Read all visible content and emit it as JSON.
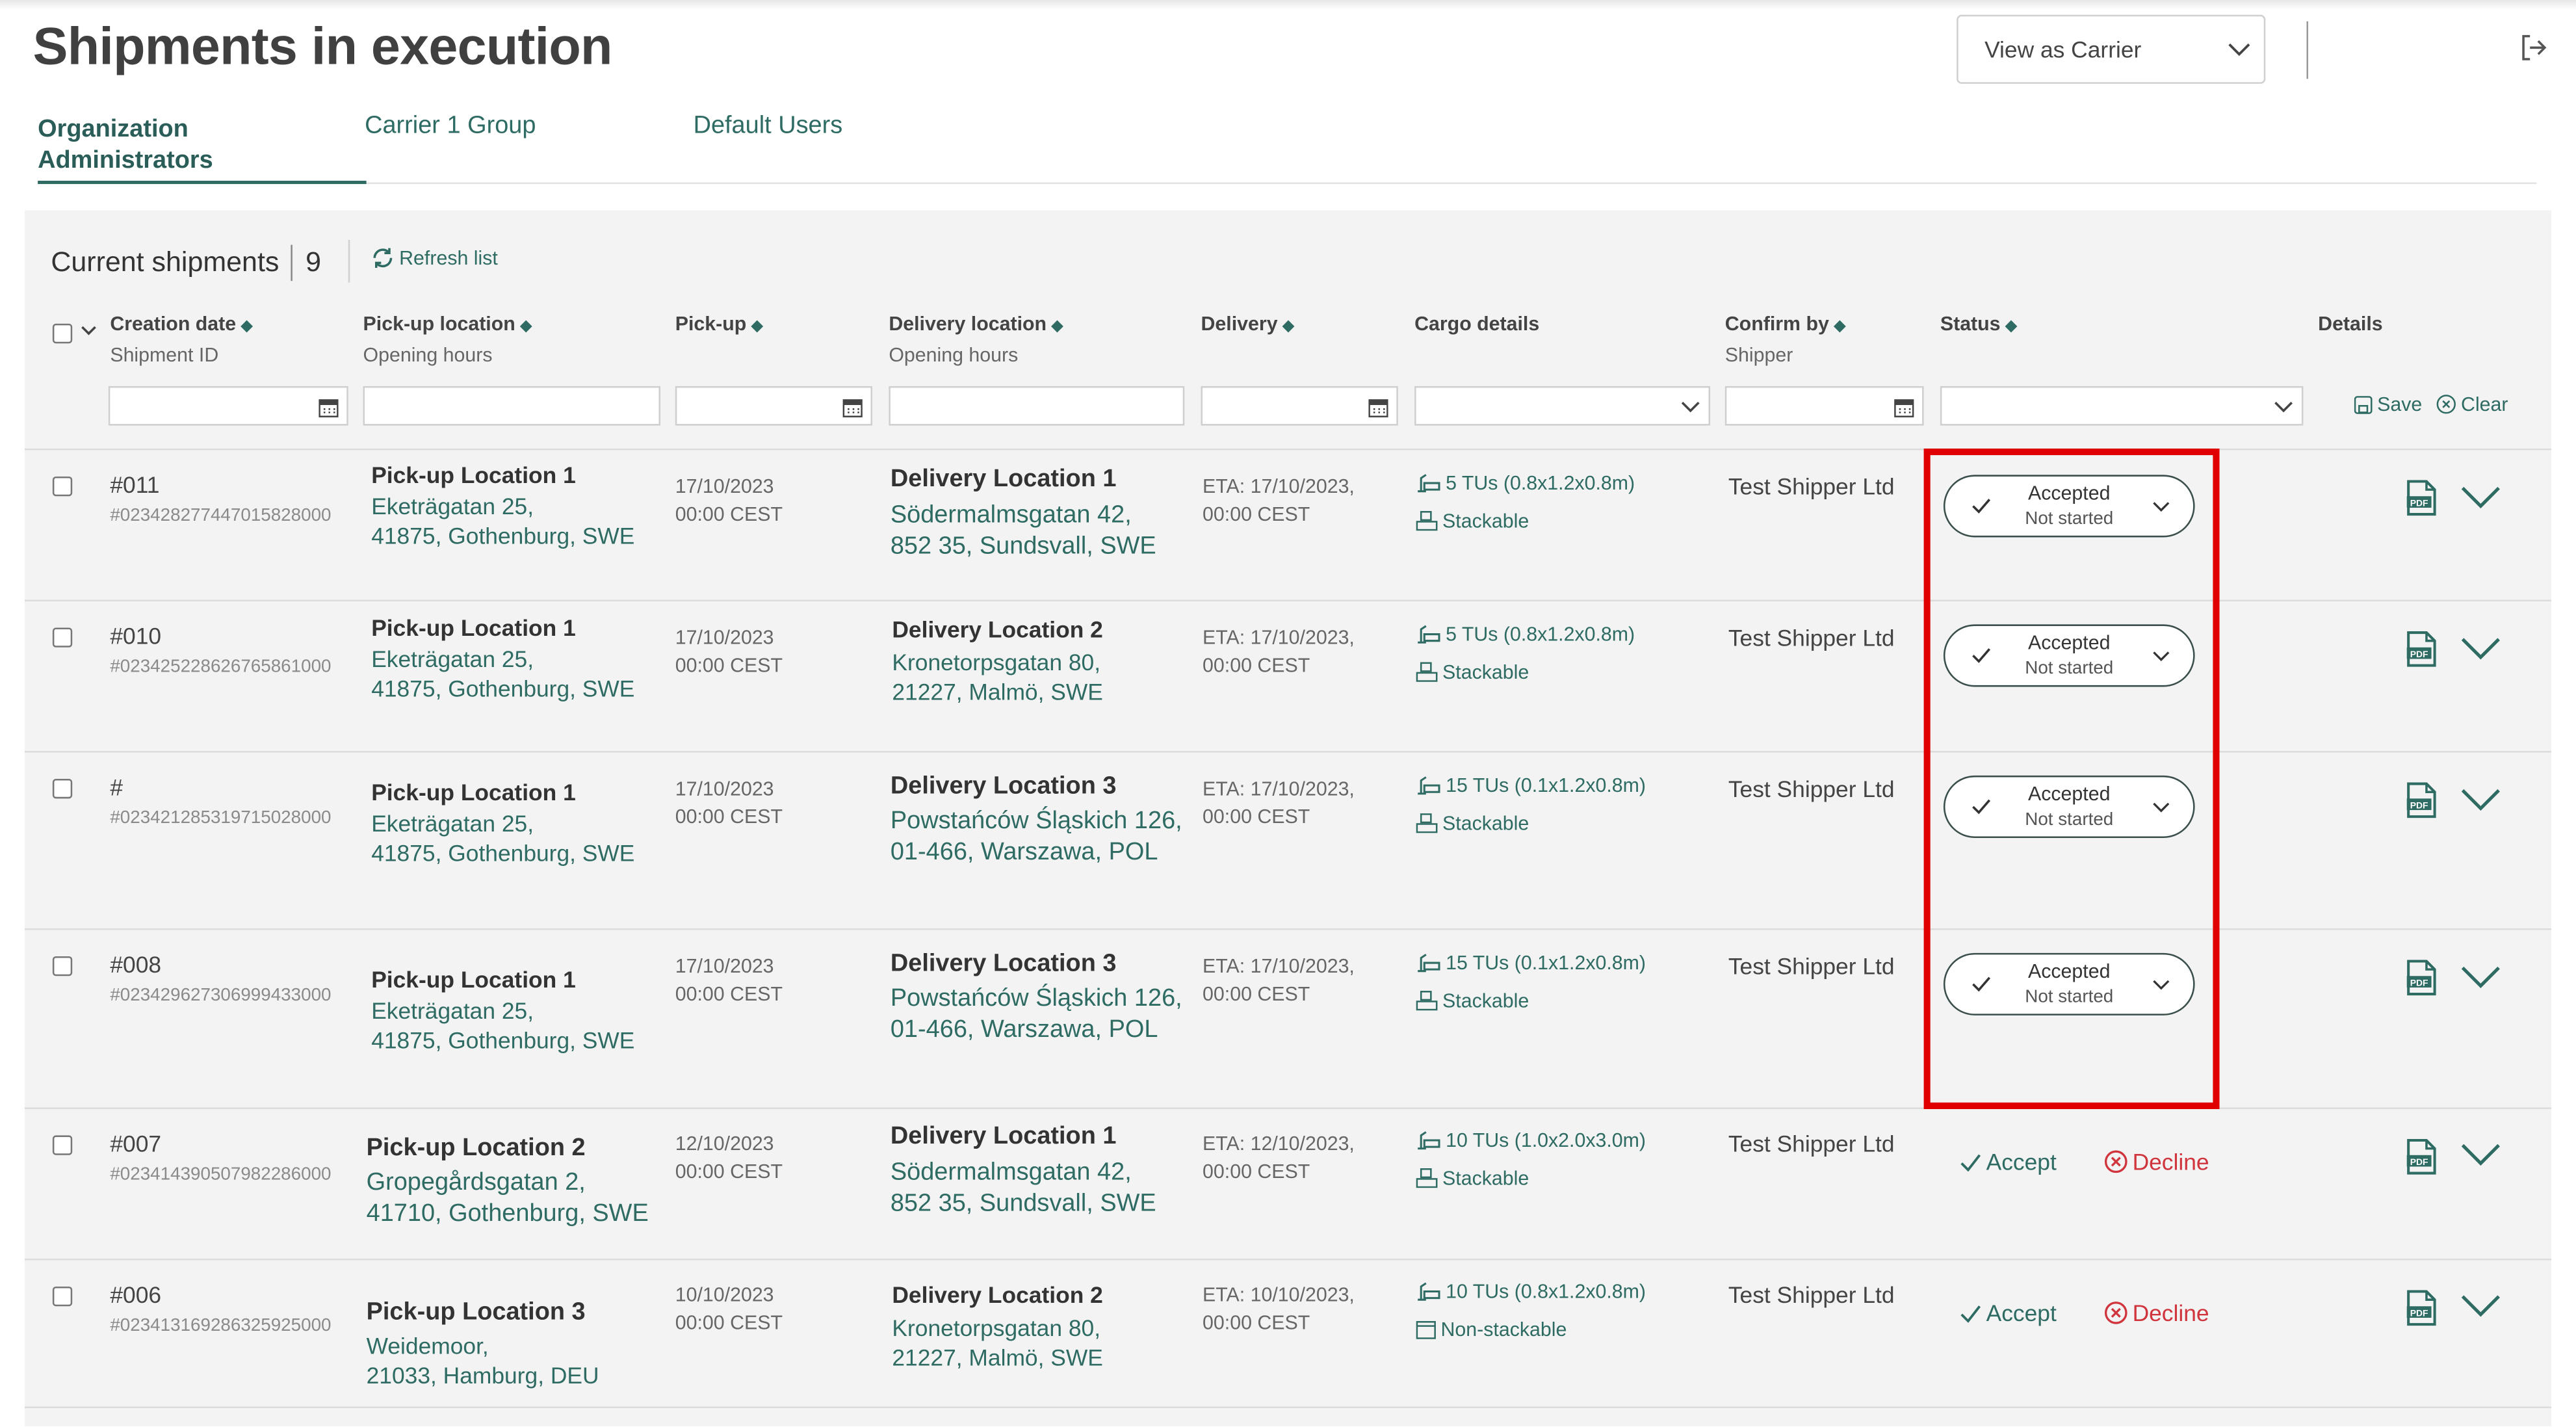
{
  "header": {
    "title": "Shipments in execution",
    "view_as": "View as Carrier"
  },
  "tabs": [
    {
      "label": "Organization Administrators",
      "active": true
    },
    {
      "label": "Carrier 1 Group",
      "active": false
    },
    {
      "label": "Default Users",
      "active": false
    }
  ],
  "toolbar": {
    "current_label": "Current shipments",
    "count": "9",
    "refresh_label": "Refresh list"
  },
  "columns": {
    "creation": "Creation date",
    "creation_sub": "Shipment ID",
    "pickup_loc": "Pick-up location",
    "pickup_loc_sub": "Opening hours",
    "pickup": "Pick-up",
    "delivery_loc": "Delivery location",
    "delivery_loc_sub": "Opening hours",
    "delivery": "Delivery",
    "cargo": "Cargo details",
    "confirm": "Confirm by",
    "confirm_sub": "Shipper",
    "status": "Status",
    "details": "Details"
  },
  "filters": {
    "save_label": "Save",
    "clear_label": "Clear"
  },
  "actions": {
    "accept": "Accept",
    "decline": "Decline"
  },
  "colors": {
    "accent": "#2e6b63",
    "decline": "#d0343c",
    "highlight": "#e00000"
  },
  "rows": [
    {
      "id": "#011",
      "long_id": "#023428277447015828000",
      "pickup_name": "Pick-up Location 1",
      "pickup_addr1": "Eketrägatan 25,",
      "pickup_addr2": "41875, Gothenburg, SWE",
      "pickup_date": "17/10/2023",
      "pickup_time": "00:00 CEST",
      "delivery_name": "Delivery Location 1",
      "delivery_addr1": "Södermalmsgatan 42,",
      "delivery_addr2": "852 35, Sundsvall, SWE",
      "eta": "ETA:  17/10/2023,",
      "eta_time": "00:00 CEST",
      "cargo": "5 TUs (0.8x1.2x0.8m)",
      "stack": "Stackable",
      "stackable": true,
      "shipper": "Test Shipper Ltd",
      "status": "Accepted",
      "status_sub": "Not started"
    },
    {
      "id": "#010",
      "long_id": "#023425228626765861000",
      "pickup_name": "Pick-up Location 1",
      "pickup_addr1": "Eketrägatan 25,",
      "pickup_addr2": "41875, Gothenburg, SWE",
      "pickup_date": "17/10/2023",
      "pickup_time": "00:00 CEST",
      "delivery_name": "Delivery Location 2",
      "delivery_addr1": "Kronetorpsgatan 80,",
      "delivery_addr2": "21227, Malmö, SWE",
      "eta": "ETA:  17/10/2023,",
      "eta_time": "00:00 CEST",
      "cargo": "5 TUs (0.8x1.2x0.8m)",
      "stack": "Stackable",
      "stackable": true,
      "shipper": "Test Shipper Ltd",
      "status": "Accepted",
      "status_sub": "Not started"
    },
    {
      "id": "#",
      "long_id": "#023421285319715028000",
      "pickup_name": "Pick-up Location 1",
      "pickup_addr1": "Eketrägatan 25,",
      "pickup_addr2": "41875, Gothenburg, SWE",
      "pickup_date": "17/10/2023",
      "pickup_time": "00:00 CEST",
      "delivery_name": "Delivery Location 3",
      "delivery_addr1": "Powstańców Śląskich 126,",
      "delivery_addr2": "01-466, Warszawa, POL",
      "eta": "ETA:  17/10/2023,",
      "eta_time": "00:00 CEST",
      "cargo": "15 TUs (0.1x1.2x0.8m)",
      "stack": "Stackable",
      "stackable": true,
      "shipper": "Test Shipper Ltd",
      "status": "Accepted",
      "status_sub": "Not started"
    },
    {
      "id": "#008",
      "long_id": "#023429627306999433000",
      "pickup_name": "Pick-up Location 1",
      "pickup_addr1": "Eketrägatan 25,",
      "pickup_addr2": "41875, Gothenburg, SWE",
      "pickup_date": "17/10/2023",
      "pickup_time": "00:00 CEST",
      "delivery_name": "Delivery Location 3",
      "delivery_addr1": "Powstańców Śląskich 126,",
      "delivery_addr2": "01-466, Warszawa, POL",
      "eta": "ETA:  17/10/2023,",
      "eta_time": "00:00 CEST",
      "cargo": "15 TUs (0.1x1.2x0.8m)",
      "stack": "Stackable",
      "stackable": true,
      "shipper": "Test Shipper Ltd",
      "status": "Accepted",
      "status_sub": "Not started"
    },
    {
      "id": "#007",
      "long_id": "#023414390507982286000",
      "pickup_name": "Pick-up Location 2",
      "pickup_addr1": "Gropegårdsgatan 2,",
      "pickup_addr2": "41710, Gothenburg, SWE",
      "pickup_date": "12/10/2023",
      "pickup_time": "00:00 CEST",
      "delivery_name": "Delivery Location 1",
      "delivery_addr1": "Södermalmsgatan 42,",
      "delivery_addr2": "852 35, Sundsvall, SWE",
      "eta": "ETA:  12/10/2023,",
      "eta_time": "00:00 CEST",
      "cargo": "10 TUs (1.0x2.0x3.0m)",
      "stack": "Stackable",
      "stackable": true,
      "shipper": "Test Shipper Ltd",
      "status": "",
      "status_sub": ""
    },
    {
      "id": "#006",
      "long_id": "#023413169286325925000",
      "pickup_name": "Pick-up Location 3",
      "pickup_addr1": "Weidemoor,",
      "pickup_addr2": "21033, Hamburg, DEU",
      "pickup_date": "10/10/2023",
      "pickup_time": "00:00 CEST",
      "delivery_name": "Delivery Location 2",
      "delivery_addr1": "Kronetorpsgatan 80,",
      "delivery_addr2": "21227, Malmö, SWE",
      "eta": "ETA:  10/10/2023,",
      "eta_time": "00:00 CEST",
      "cargo": "10 TUs (0.8x1.2x0.8m)",
      "stack": "Non-stackable",
      "stackable": false,
      "shipper": "Test Shipper Ltd",
      "status": "",
      "status_sub": ""
    }
  ]
}
